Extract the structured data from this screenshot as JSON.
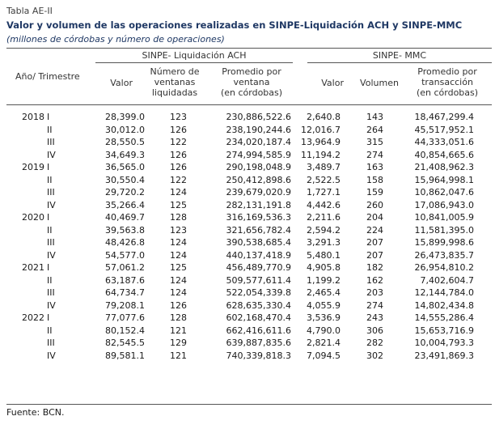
{
  "header": {
    "table_id": "Tabla AE-II",
    "title": "Valor y volumen de las operaciones realizadas en SINPE-Liquidación ACH y SINPE-MMC",
    "subtitle": "(millones de córdobas y número de operaciones)"
  },
  "columns": {
    "group_ach": "SINPE- Liquidación ACH",
    "group_mmc": "SINPE- MMC",
    "period": "Año/ Trimestre",
    "ach_valor": "Valor",
    "ach_numero": [
      "Número de",
      "ventanas",
      "liquidadas"
    ],
    "ach_promedio": [
      "Promedio por",
      "ventana",
      "(en córdobas)"
    ],
    "mmc_valor": "Valor",
    "mmc_volumen": "Volumen",
    "mmc_promedio": [
      "Promedio por",
      "transacción",
      "(en córdobas)"
    ]
  },
  "rows": [
    {
      "year": "2018",
      "q": "I",
      "ach_valor": "28,399.0",
      "ach_num": "123",
      "ach_prom": "230,886,522.6",
      "mmc_valor": "2,640.8",
      "mmc_vol": "143",
      "mmc_prom": "18,467,299.4"
    },
    {
      "year": "",
      "q": "II",
      "ach_valor": "30,012.0",
      "ach_num": "126",
      "ach_prom": "238,190,244.6",
      "mmc_valor": "12,016.7",
      "mmc_vol": "264",
      "mmc_prom": "45,517,952.1"
    },
    {
      "year": "",
      "q": "III",
      "ach_valor": "28,550.5",
      "ach_num": "122",
      "ach_prom": "234,020,187.4",
      "mmc_valor": "13,964.9",
      "mmc_vol": "315",
      "mmc_prom": "44,333,051.6"
    },
    {
      "year": "",
      "q": "IV",
      "ach_valor": "34,649.3",
      "ach_num": "126",
      "ach_prom": "274,994,585.9",
      "mmc_valor": "11,194.2",
      "mmc_vol": "274",
      "mmc_prom": "40,854,665.6"
    },
    {
      "year": "2019",
      "q": "I",
      "ach_valor": "36,565.0",
      "ach_num": "126",
      "ach_prom": "290,198,048.9",
      "mmc_valor": "3,489.7",
      "mmc_vol": "163",
      "mmc_prom": "21,408,962.3"
    },
    {
      "year": "",
      "q": "II",
      "ach_valor": "30,550.4",
      "ach_num": "122",
      "ach_prom": "250,412,898.6",
      "mmc_valor": "2,522.5",
      "mmc_vol": "158",
      "mmc_prom": "15,964,998.1"
    },
    {
      "year": "",
      "q": "III",
      "ach_valor": "29,720.2",
      "ach_num": "124",
      "ach_prom": "239,679,020.9",
      "mmc_valor": "1,727.1",
      "mmc_vol": "159",
      "mmc_prom": "10,862,047.6"
    },
    {
      "year": "",
      "q": "IV",
      "ach_valor": "35,266.4",
      "ach_num": "125",
      "ach_prom": "282,131,191.8",
      "mmc_valor": "4,442.6",
      "mmc_vol": "260",
      "mmc_prom": "17,086,943.0"
    },
    {
      "year": "2020",
      "q": "I",
      "ach_valor": "40,469.7",
      "ach_num": "128",
      "ach_prom": "316,169,536.3",
      "mmc_valor": "2,211.6",
      "mmc_vol": "204",
      "mmc_prom": "10,841,005.9"
    },
    {
      "year": "",
      "q": "II",
      "ach_valor": "39,563.8",
      "ach_num": "123",
      "ach_prom": "321,656,782.4",
      "mmc_valor": "2,594.2",
      "mmc_vol": "224",
      "mmc_prom": "11,581,395.0"
    },
    {
      "year": "",
      "q": "III",
      "ach_valor": "48,426.8",
      "ach_num": "124",
      "ach_prom": "390,538,685.4",
      "mmc_valor": "3,291.3",
      "mmc_vol": "207",
      "mmc_prom": "15,899,998.6"
    },
    {
      "year": "",
      "q": "IV",
      "ach_valor": "54,577.0",
      "ach_num": "124",
      "ach_prom": "440,137,418.9",
      "mmc_valor": "5,480.1",
      "mmc_vol": "207",
      "mmc_prom": "26,473,835.7"
    },
    {
      "year": "2021",
      "q": "I",
      "ach_valor": "57,061.2",
      "ach_num": "125",
      "ach_prom": "456,489,770.9",
      "mmc_valor": "4,905.8",
      "mmc_vol": "182",
      "mmc_prom": "26,954,810.2"
    },
    {
      "year": "",
      "q": "II",
      "ach_valor": "63,187.6",
      "ach_num": "124",
      "ach_prom": "509,577,611.4",
      "mmc_valor": "1,199.2",
      "mmc_vol": "162",
      "mmc_prom": "7,402,604.7"
    },
    {
      "year": "",
      "q": "III",
      "ach_valor": "64,734.7",
      "ach_num": "124",
      "ach_prom": "522,054,339.8",
      "mmc_valor": "2,465.4",
      "mmc_vol": "203",
      "mmc_prom": "12,144,784.0"
    },
    {
      "year": "",
      "q": "IV",
      "ach_valor": "79,208.1",
      "ach_num": "126",
      "ach_prom": "628,635,330.4",
      "mmc_valor": "4,055.9",
      "mmc_vol": "274",
      "mmc_prom": "14,802,434.8"
    },
    {
      "year": "2022",
      "q": "I",
      "ach_valor": "77,077.6",
      "ach_num": "128",
      "ach_prom": "602,168,470.4",
      "mmc_valor": "3,536.9",
      "mmc_vol": "243",
      "mmc_prom": "14,555,286.4"
    },
    {
      "year": "",
      "q": "II",
      "ach_valor": "80,152.4",
      "ach_num": "121",
      "ach_prom": "662,416,611.6",
      "mmc_valor": "4,790.0",
      "mmc_vol": "306",
      "mmc_prom": "15,653,716.9"
    },
    {
      "year": "",
      "q": "III",
      "ach_valor": "82,545.5",
      "ach_num": "129",
      "ach_prom": "639,887,835.6",
      "mmc_valor": "2,821.4",
      "mmc_vol": "282",
      "mmc_prom": "10,004,793.3"
    },
    {
      "year": "",
      "q": "IV",
      "ach_valor": "89,581.1",
      "ach_num": "121",
      "ach_prom": "740,339,818.3",
      "mmc_valor": "7,094.5",
      "mmc_vol": "302",
      "mmc_prom": "23,491,869.3"
    }
  ],
  "footer": {
    "source": "Fuente: BCN."
  }
}
